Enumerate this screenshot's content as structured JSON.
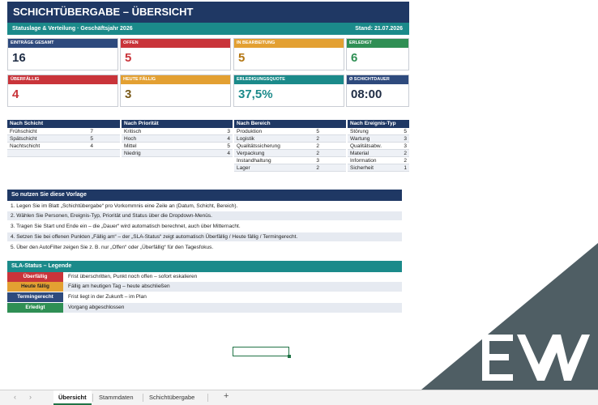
{
  "header": {
    "title": "SCHICHTÜBERGABE – ÜBERSICHT",
    "subtitle": "Statuslage & Verteilung · Geschäftsjahr 2026",
    "stand": "Stand: 21.07.2026"
  },
  "kpis": [
    {
      "label": "EINTRÄGE GESAMT",
      "value": "16",
      "color": "#2e4a7d",
      "valcolor": "#1f2d45"
    },
    {
      "label": "OFFEN",
      "value": "5",
      "color": "#c9343a",
      "valcolor": "#c9343a"
    },
    {
      "label": "IN BEARBEITUNG",
      "value": "5",
      "color": "#e3a032",
      "valcolor": "#b37613"
    },
    {
      "label": "ERLEDIGT",
      "value": "6",
      "color": "#2f8f54",
      "valcolor": "#2f8f54"
    },
    {
      "label": "ÜBERFÄLLIG",
      "value": "4",
      "color": "#c9343a",
      "valcolor": "#c9343a"
    },
    {
      "label": "HEUTE FÄLLIG",
      "value": "3",
      "color": "#e3a032",
      "valcolor": "#7a5a1a"
    },
    {
      "label": "ERLEDIGUNGSQUOTE",
      "value": "37,5%",
      "color": "#1b8a8a",
      "valcolor": "#1b8a8a"
    },
    {
      "label": "Ø SCHICHTDAUER",
      "value": "08:00",
      "color": "#2e4a7d",
      "valcolor": "#1f2d45"
    }
  ],
  "breakdowns": {
    "schicht": {
      "header": "Nach Schicht",
      "rows": [
        [
          "Frühschicht",
          "7"
        ],
        [
          "Spätschicht",
          "5"
        ],
        [
          "Nachtschicht",
          "4"
        ]
      ]
    },
    "prioritaet": {
      "header": "Nach Priorität",
      "rows": [
        [
          "Kritisch",
          "3"
        ],
        [
          "Hoch",
          "4"
        ],
        [
          "Mittel",
          "5"
        ],
        [
          "Niedrig",
          "4"
        ]
      ]
    },
    "bereich": {
      "header": "Nach Bereich",
      "rows": [
        [
          "Produktion",
          "5"
        ],
        [
          "Logistik",
          "2"
        ],
        [
          "Qualitätssicherung",
          "2"
        ],
        [
          "Verpackung",
          "2"
        ],
        [
          "Instandhaltung",
          "3"
        ],
        [
          "Lager",
          "2"
        ]
      ]
    },
    "ereignis": {
      "header": "Nach Ereignis-Typ",
      "rows": [
        [
          "Störung",
          "5"
        ],
        [
          "Wartung",
          "3"
        ],
        [
          "Qualitätsabw.",
          "3"
        ],
        [
          "Material",
          "2"
        ],
        [
          "Information",
          "2"
        ],
        [
          "Sicherheit",
          "1"
        ]
      ]
    }
  },
  "howto": {
    "header": "So nutzen Sie diese Vorlage",
    "steps": [
      "1.  Legen Sie im Blatt „Schichtübergabe“ pro Vorkommnis eine Zeile an (Datum, Schicht, Bereich).",
      "2.  Wählen Sie Personen, Ereignis-Typ, Priorität und Status über die Dropdown-Menüs.",
      "3.  Tragen Sie Start und Ende ein – die „Dauer“ wird automatisch berechnet, auch über Mitternacht.",
      "4.  Setzen Sie bei offenen Punkten „Fällig am“ – der „SLA-Status“ zeigt automatisch Überfällig / Heute fällig / Termingerecht.",
      "5.  Über den AutoFilter zeigen Sie z. B. nur „Offen“ oder „Überfällig“ für den Tagesfokus."
    ]
  },
  "legend": {
    "header": "SLA-Status – Legende",
    "items": [
      {
        "label": "Überfällig",
        "desc": "Frist überschritten, Punkt noch offen – sofort eskalieren",
        "color": "#c9343a"
      },
      {
        "label": "Heute fällig",
        "desc": "Fällig am heutigen Tag – heute abschließen",
        "color": "#e3a032"
      },
      {
        "label": "Termingerecht",
        "desc": "Frist liegt in der Zukunft – im Plan",
        "color": "#2e4a7d"
      },
      {
        "label": "Erledigt",
        "desc": "Vorgang abgeschlossen",
        "color": "#2f8f54"
      }
    ]
  },
  "tabs": [
    "Übersicht",
    "Stammdaten",
    "Schichtübergabe"
  ],
  "tab_add": "+"
}
